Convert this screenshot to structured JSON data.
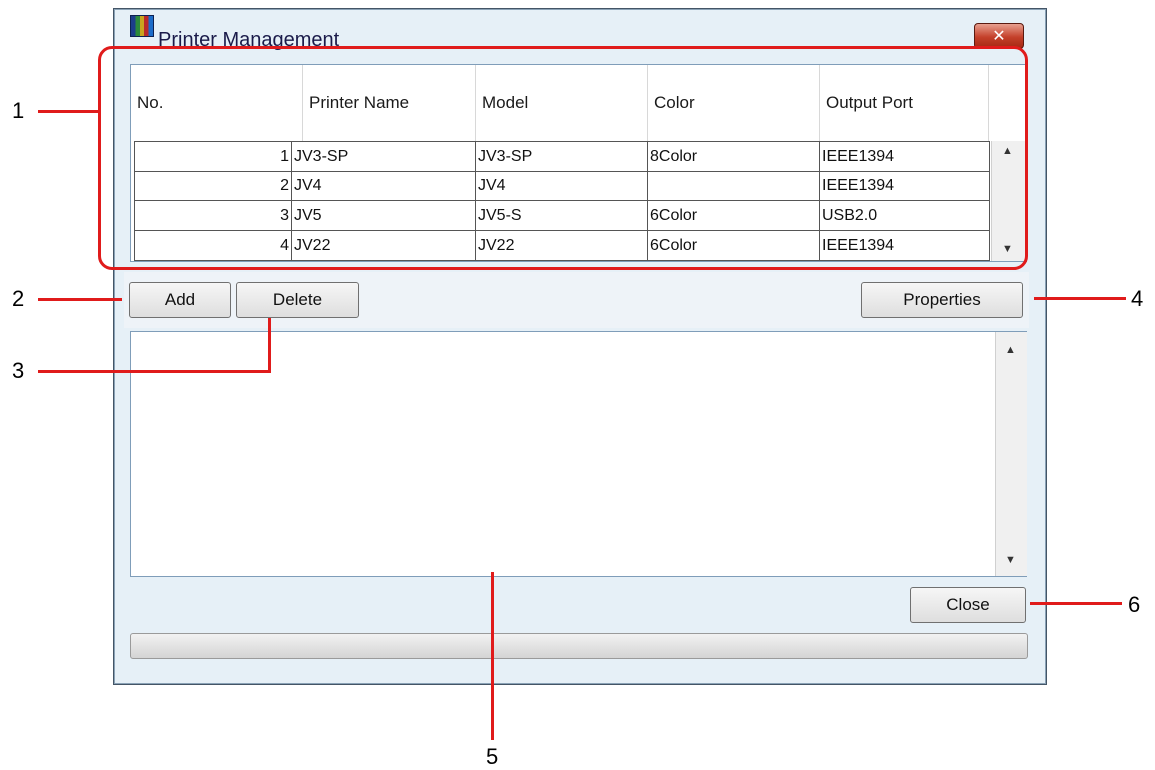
{
  "window": {
    "title": "Printer Management",
    "close_glyph": "✕"
  },
  "table": {
    "columns": [
      "No.",
      "Printer Name",
      "Model",
      "Color",
      "Output Port"
    ],
    "rows": [
      [
        "1",
        "JV3-SP",
        "JV3-SP",
        "8Color",
        "IEEE1394"
      ],
      [
        "2",
        "JV4",
        "JV4",
        "",
        "IEEE1394"
      ],
      [
        "3",
        "JV5",
        "JV5-S",
        "6Color",
        "USB2.0"
      ],
      [
        "4",
        "JV22",
        "JV22",
        "6Color",
        "IEEE1394"
      ]
    ],
    "scroll_up_glyph": "▲",
    "scroll_down_glyph": "▼"
  },
  "buttons": {
    "add": "Add",
    "delete": "Delete",
    "properties": "Properties",
    "close": "Close"
  },
  "callouts": [
    "1",
    "2",
    "3",
    "4",
    "5",
    "6"
  ],
  "colors": {
    "annotation_red": "#e01b1b",
    "window_bg": "#e6f0f7"
  }
}
